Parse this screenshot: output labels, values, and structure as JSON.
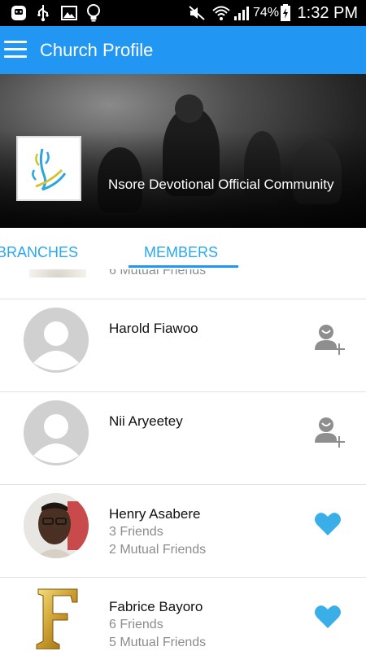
{
  "status_bar": {
    "battery": "74%",
    "time": "1:32 PM",
    "icons": [
      "messenger-icon",
      "usb-icon",
      "image-icon",
      "bulb-icon",
      "mute-icon",
      "wifi-icon",
      "signal-icon",
      "battery-charging-icon"
    ]
  },
  "app_bar": {
    "title": "Church Profile",
    "menu_icon": "hamburger-menu-icon",
    "color": "#2196F3"
  },
  "header": {
    "community_name": "Nsore Devotional Official Community"
  },
  "tabs": {
    "items": [
      {
        "label": "BRANCHES",
        "active": false
      },
      {
        "label": "MEMBERS",
        "active": true
      }
    ],
    "accent": "#2196F3"
  },
  "members": {
    "partial_item": {
      "mutual": "6 Mutual Friends"
    },
    "items": [
      {
        "name": "Harold Fiawoo",
        "friends": "",
        "mutual": "",
        "avatar": "default-avatar",
        "action": "add-friend-icon"
      },
      {
        "name": "Nii Aryeetey",
        "friends": "",
        "mutual": "",
        "avatar": "default-avatar",
        "action": "add-friend-icon"
      },
      {
        "name": "Henry Asabere",
        "friends": "3 Friends",
        "mutual": "2 Mutual Friends",
        "avatar": "photo-avatar",
        "action": "heart-icon"
      },
      {
        "name": "Fabrice Bayoro",
        "friends": "6 Friends",
        "mutual": "5 Mutual Friends",
        "avatar": "letter-f-avatar",
        "action": "heart-icon"
      }
    ],
    "heart_color": "#3aaee6"
  }
}
